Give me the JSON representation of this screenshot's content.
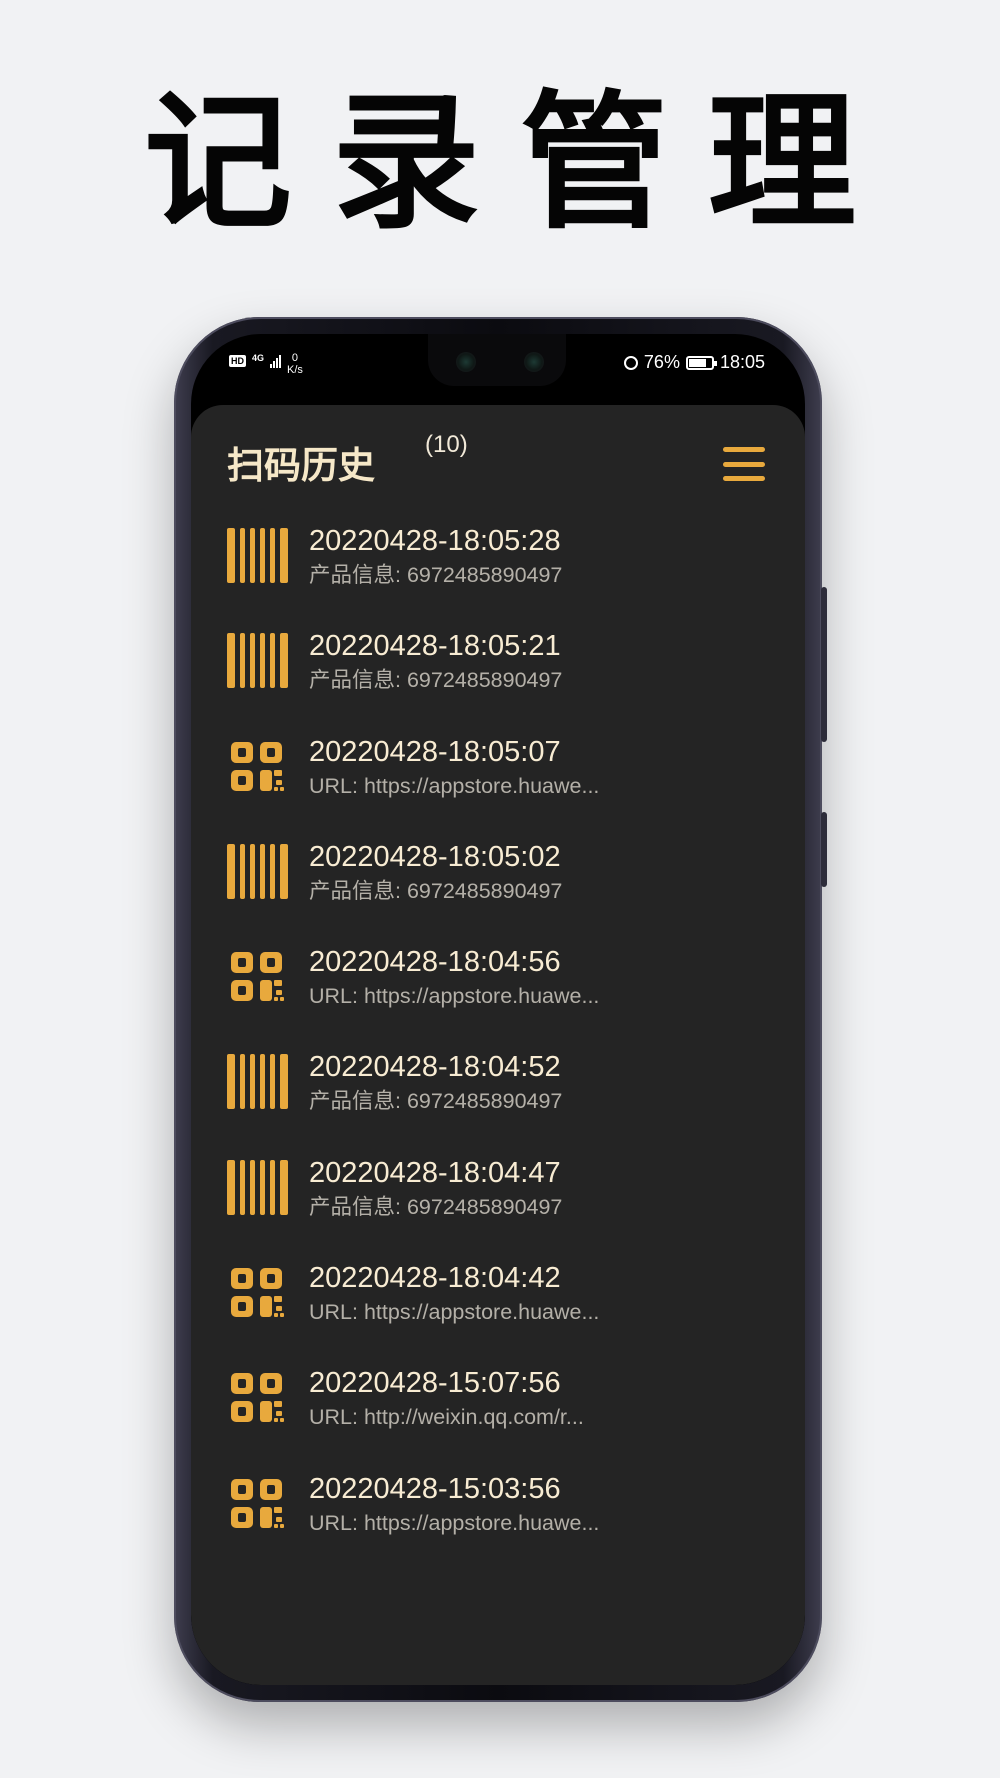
{
  "headline": "记录管理",
  "status_bar": {
    "hd": "HD",
    "network": "4G",
    "speed_value": "0",
    "speed_unit": "K/s",
    "battery": "76%",
    "battery_level": 0.76,
    "time": "18:05"
  },
  "app": {
    "title": "扫码历史",
    "count": "(10)",
    "menu_icon": "menu-icon",
    "accent_color": "#e8a93d"
  },
  "history": [
    {
      "type": "barcode",
      "time": "20220428-18:05:28",
      "desc": "产品信息: 6972485890497"
    },
    {
      "type": "barcode",
      "time": "20220428-18:05:21",
      "desc": "产品信息: 6972485890497"
    },
    {
      "type": "qrcode",
      "time": "20220428-18:05:07",
      "desc": "URL: https://appstore.huawe..."
    },
    {
      "type": "barcode",
      "time": "20220428-18:05:02",
      "desc": "产品信息: 6972485890497"
    },
    {
      "type": "qrcode",
      "time": "20220428-18:04:56",
      "desc": "URL: https://appstore.huawe..."
    },
    {
      "type": "barcode",
      "time": "20220428-18:04:52",
      "desc": "产品信息: 6972485890497"
    },
    {
      "type": "barcode",
      "time": "20220428-18:04:47",
      "desc": "产品信息: 6972485890497"
    },
    {
      "type": "qrcode",
      "time": "20220428-18:04:42",
      "desc": "URL: https://appstore.huawe..."
    },
    {
      "type": "qrcode",
      "time": "20220428-15:07:56",
      "desc": "URL: http://weixin.qq.com/r..."
    },
    {
      "type": "qrcode",
      "time": "20220428-15:03:56",
      "desc": "URL: https://appstore.huawe..."
    }
  ]
}
